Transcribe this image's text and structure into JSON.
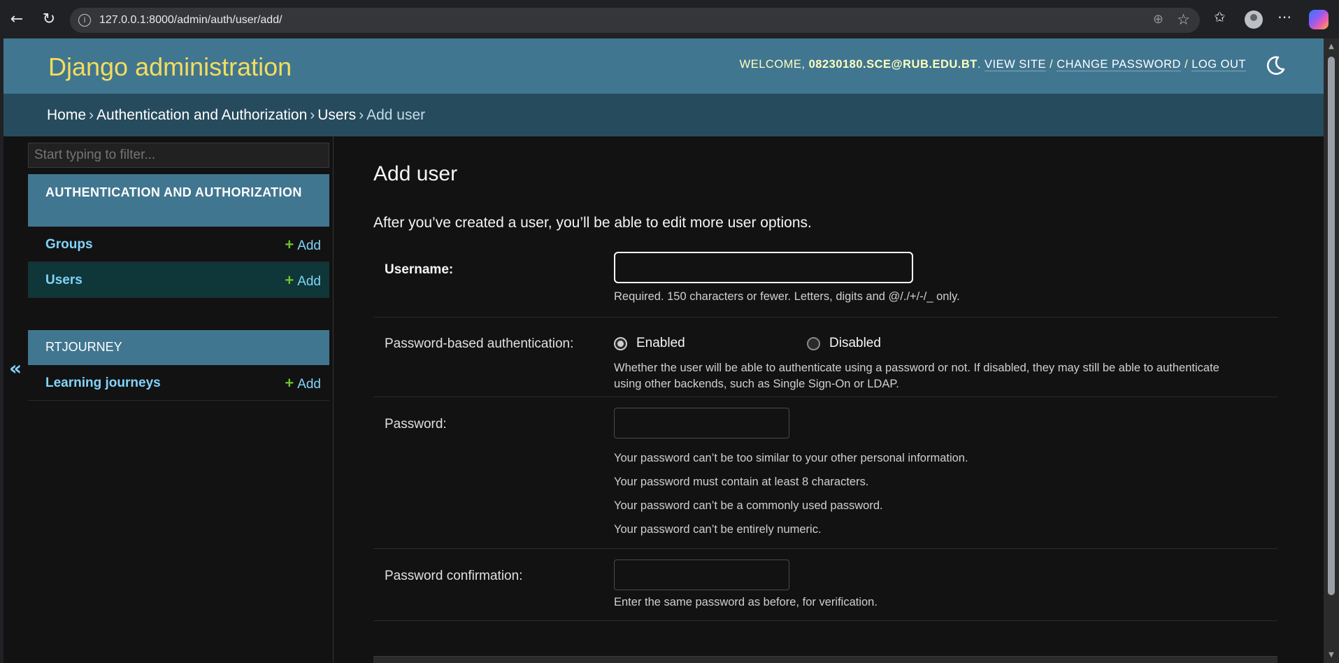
{
  "browser": {
    "url": "127.0.0.1:8000/admin/auth/user/add/"
  },
  "header": {
    "site_title": "Django administration",
    "welcome": "Welcome,",
    "username": "08230180.sce@rub.edu.bt",
    "view_site": "View site",
    "change_password": "Change password",
    "log_out": "Log out"
  },
  "breadcrumbs": {
    "home": "Home",
    "app": "Authentication and Authorization",
    "model": "Users",
    "current": "Add user"
  },
  "sidebar": {
    "filter_placeholder": "Start typing to filter...",
    "apps": [
      {
        "name": "Authentication and Authorization",
        "models": [
          {
            "name": "Groups",
            "add": "Add"
          },
          {
            "name": "Users",
            "add": "Add"
          }
        ]
      },
      {
        "name": "RTJOURNEY",
        "models": [
          {
            "name": "Learning journeys",
            "add": "Add"
          }
        ]
      }
    ],
    "collapse_glyph": "«"
  },
  "content": {
    "title": "Add user",
    "intro": "After you’ve created a user, you’ll be able to edit more user options.",
    "username": {
      "label": "Username:",
      "help": "Required. 150 characters or fewer. Letters, digits and @/./+/-/_ only."
    },
    "password_auth": {
      "label": "Password-based authentication:",
      "option_enabled": "Enabled",
      "option_disabled": "Disabled",
      "selected": "Enabled",
      "help_line1": "Whether the user will be able to authenticate using a password or not. If disabled, they may still be able to authenticate",
      "help_line2": "using other backends, such as Single Sign-On or LDAP."
    },
    "password": {
      "label": "Password:",
      "help": [
        "Your password can’t be too similar to your other personal information.",
        "Your password must contain at least 8 characters.",
        "Your password can’t be a commonly used password.",
        "Your password can’t be entirely numeric."
      ]
    },
    "password_confirmation": {
      "label": "Password confirmation:",
      "help": "Enter the same password as before, for verification."
    }
  },
  "colors": {
    "header_bg": "#417690",
    "breadcrumbs_bg": "#264b5d",
    "site_title": "#f5dd5d",
    "link": "#81d4fa",
    "add_plus": "#70bf2b",
    "body_bg": "#121212"
  },
  "icons": [
    "back-arrow-icon",
    "refresh-icon",
    "info-icon",
    "zoom-icon",
    "star-icon",
    "favorites-icon",
    "profile-icon",
    "more-icon",
    "copilot-icon",
    "moon-icon",
    "plus-icon",
    "collapse-icon"
  ]
}
